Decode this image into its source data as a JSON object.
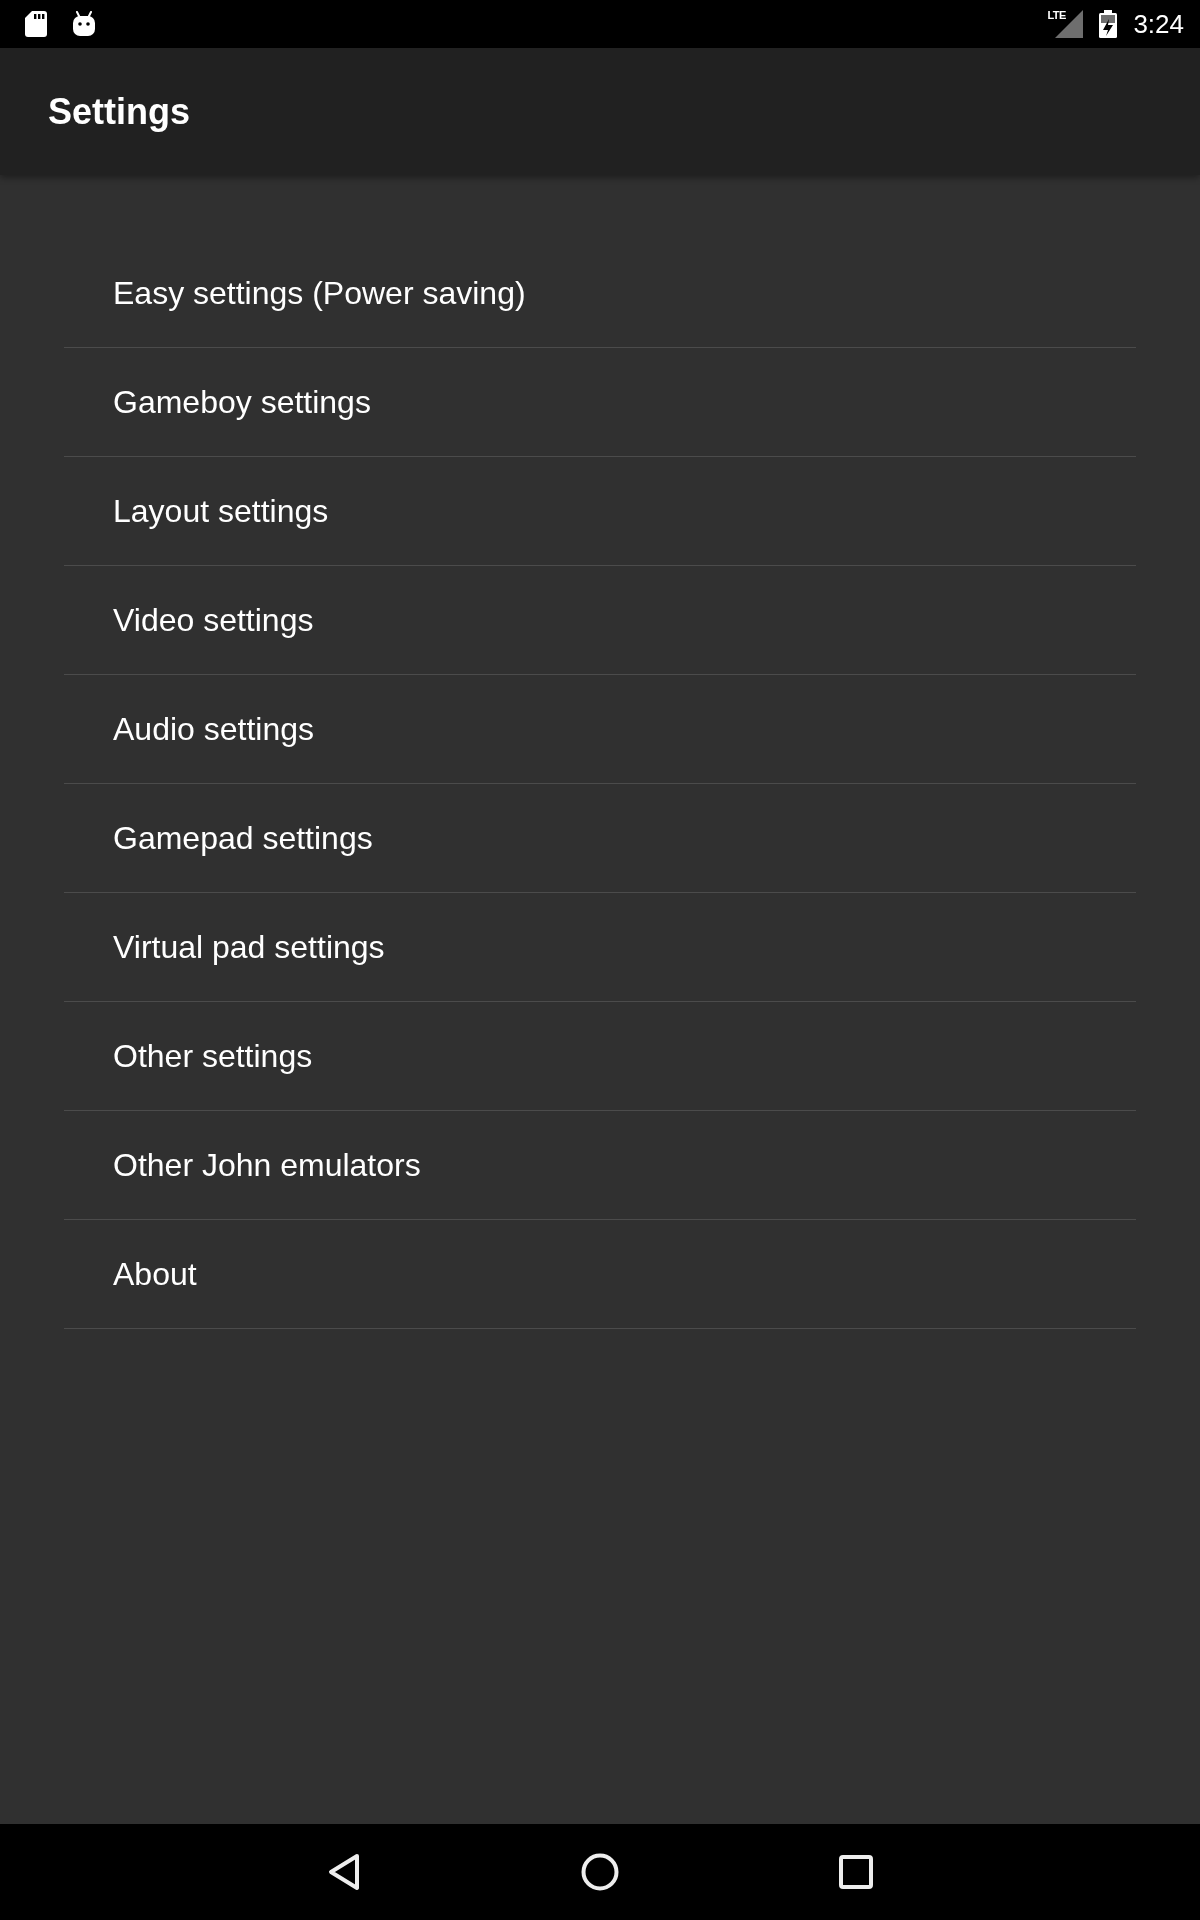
{
  "status_bar": {
    "network": "LTE",
    "time": "3:24"
  },
  "app_bar": {
    "title": "Settings"
  },
  "settings_list": {
    "items": [
      {
        "label": "Easy settings (Power saving)"
      },
      {
        "label": "Gameboy settings"
      },
      {
        "label": "Layout settings"
      },
      {
        "label": "Video settings"
      },
      {
        "label": "Audio settings"
      },
      {
        "label": "Gamepad settings"
      },
      {
        "label": "Virtual pad settings"
      },
      {
        "label": "Other settings"
      },
      {
        "label": "Other John emulators"
      },
      {
        "label": "About"
      }
    ]
  }
}
